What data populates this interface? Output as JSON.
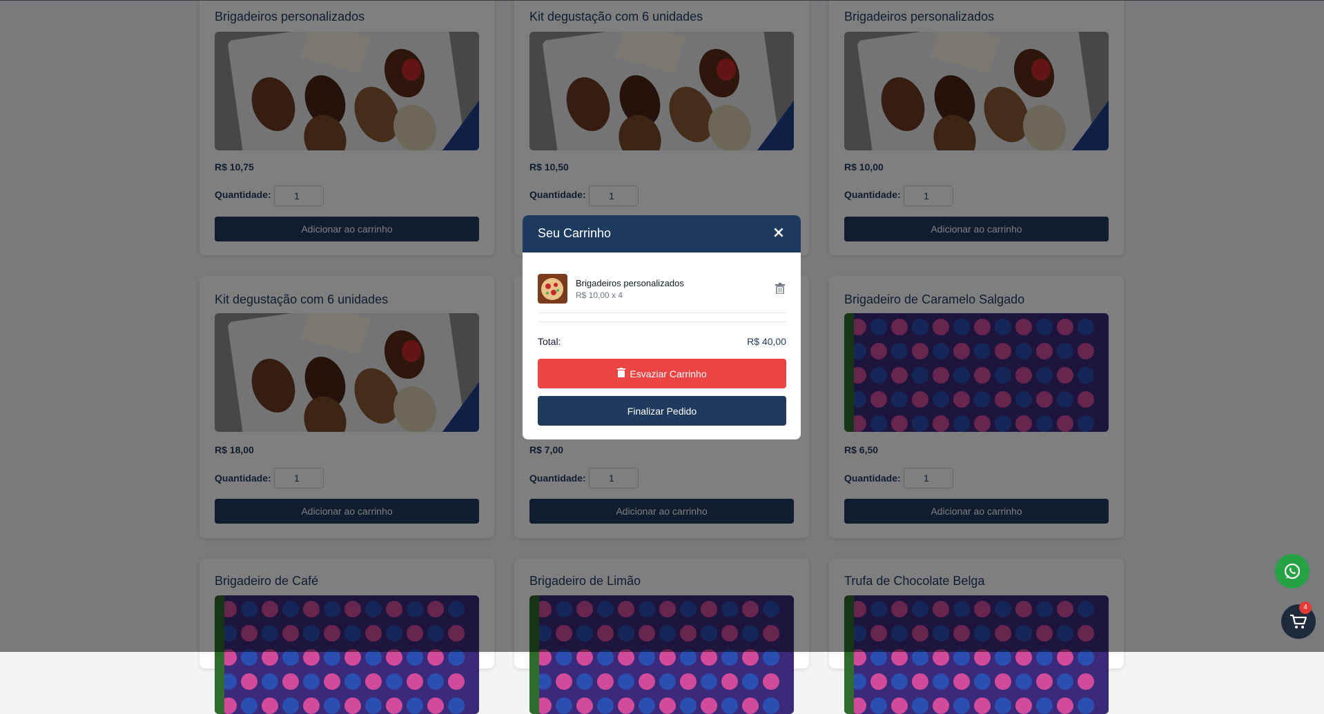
{
  "products": [
    {
      "title": "Brigadeiros personalizados",
      "price": "R$ 10,75",
      "qty": "1",
      "image": "chocolate-tray"
    },
    {
      "title": "Kit degustação com 6 unidades",
      "price": "R$ 10,50",
      "qty": "1",
      "image": "chocolate-tray"
    },
    {
      "title": "Brigadeiros personalizados",
      "price": "R$ 10,00",
      "qty": "1",
      "image": "chocolate-tray"
    },
    {
      "title": "Kit degustação com 6 unidades",
      "price": "R$ 18,00",
      "qty": "1",
      "image": "chocolate-tray"
    },
    {
      "title": "",
      "price": "R$ 7,00",
      "qty": "1",
      "image": "chocolate-tray"
    },
    {
      "title": "Brigadeiro de Caramelo Salgado",
      "price": "R$ 6,50",
      "qty": "1",
      "image": "candy-box"
    },
    {
      "title": "Brigadeiro de Café",
      "price": "",
      "qty": "",
      "image": "candy-box"
    },
    {
      "title": "Brigadeiro de Limão",
      "price": "",
      "qty": "",
      "image": "candy-box"
    },
    {
      "title": "Trufa de Chocolate Belga",
      "price": "",
      "qty": "",
      "image": "candy-box"
    }
  ],
  "labels": {
    "quantity": "Quantidade:",
    "add_to_cart": "Adicionar ao carrinho"
  },
  "cart_modal": {
    "title": "Seu Carrinho",
    "close": "×",
    "item": {
      "name": "Brigadeiros personalizados",
      "meta": "R$ 10,00 x 4"
    },
    "total_label": "Total:",
    "total_value": "R$ 40,00",
    "empty_label": "Esvaziar Carrinho",
    "finish_label": "Finalizar Pedido"
  },
  "floating": {
    "cart_count": "4",
    "whatsapp_icon": "whatsapp-icon",
    "cart_icon": "shopping-cart-icon"
  },
  "colors": {
    "primary": "#1e3a5f",
    "danger": "#ef4444",
    "whatsapp": "#25a244",
    "badge": "#e53935"
  }
}
